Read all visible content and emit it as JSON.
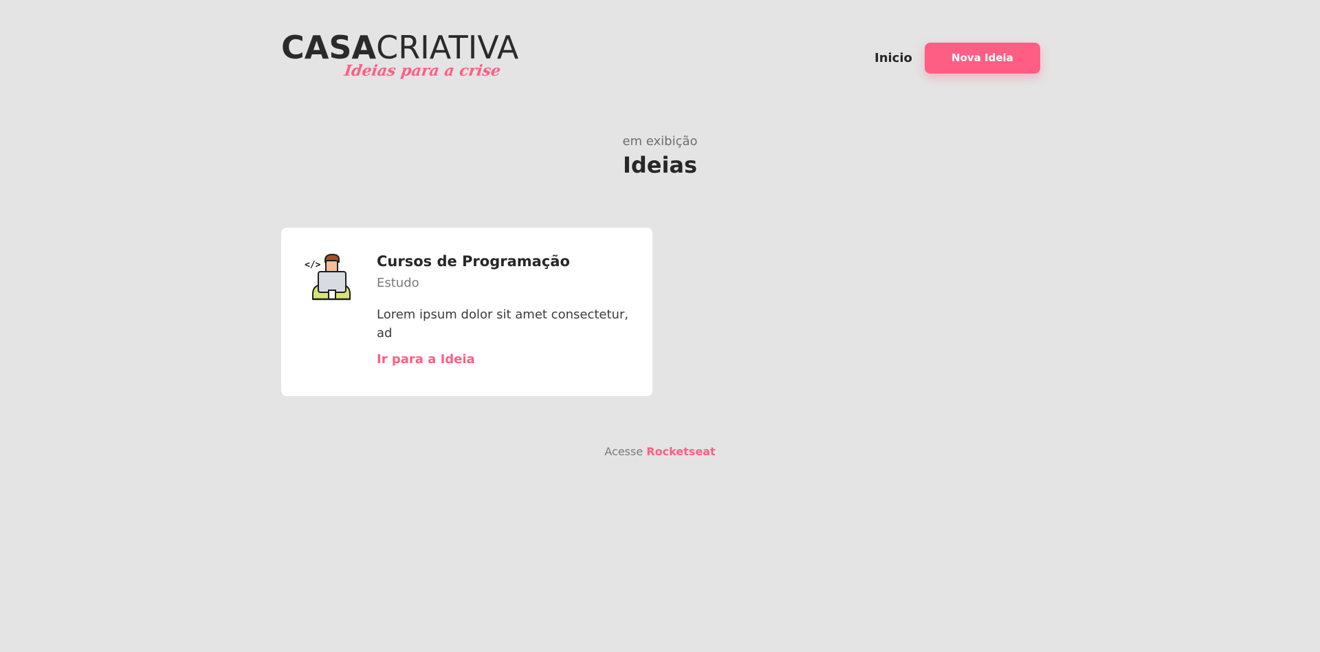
{
  "header": {
    "logo": {
      "part1": "CASA",
      "part2": "CRIATIVA",
      "tagline": "Ideias para a crise"
    },
    "nav": {
      "home_label": "Inicio",
      "new_idea_label": "Nova Ideia"
    }
  },
  "main": {
    "subtitle": "em exibição",
    "title": "Ideias",
    "ideas": [
      {
        "icon": "programmer-laptop-icon",
        "title": "Cursos de Programação",
        "category": "Estudo",
        "description": "Lorem ipsum dolor sit amet consectetur, ad",
        "link_label": "Ir para a Ideia"
      }
    ]
  },
  "footer": {
    "prefix": "Acesse",
    "link_label": "Rocketseat"
  },
  "colors": {
    "background": "#e4e4e4",
    "accent": "#ff5e84",
    "text": "#272727",
    "card": "#ffffff"
  }
}
